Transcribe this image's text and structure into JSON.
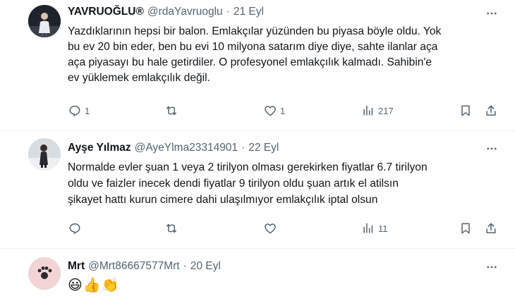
{
  "tweets": [
    {
      "name": "YAVRUOĞLU®",
      "handle": "@rdaYavruoglu",
      "separator": "·",
      "date": "21 Eyl",
      "lines": [
        "Yazdıklarının hepsi bir balon. Emlakçılar yüzünden bu piyasa böyle oldu. Yok",
        "bu ev 20 bin eder, ben bu evi 10 milyona satarım diye diye, sahte ilanlar aça",
        "aça piyasayı bu hale getirdiler. O profesyonel emlakçılık kalmadı. Sahibin'e",
        "ev yüklemek emlakçılık değil."
      ],
      "replies": "1",
      "retweets": "",
      "likes": "1",
      "views": "217"
    },
    {
      "name": "Ayşe Yılmaz",
      "handle": "@AyeYlma23314901",
      "separator": "·",
      "date": "22 Eyl",
      "lines": [
        "Normalde evler şuan 1 veya 2 tirilyon olması gerekirken fiyatlar 6.7 tirilyon",
        "oldu ve faizler inecek dendi fiyatlar 9 tirilyon oldu şuan artık el atilsın",
        "şikayet hattı kurun cimere dahi ulaşılmıyor emlakçılık iptal olsun"
      ],
      "replies": "",
      "retweets": "",
      "likes": "",
      "views": "11"
    },
    {
      "name": "Mrt",
      "handle": "@Mrt86667577Mrt",
      "separator": "·",
      "date": "20 Eyl",
      "emojis": "😃👍👏"
    }
  ],
  "colors": {
    "text": "#0f1419",
    "secondary": "#536471",
    "divider": "#eff3f4"
  },
  "icons": [
    "more-icon",
    "reply-icon",
    "retweet-icon",
    "like-icon",
    "views-icon",
    "bookmark-icon",
    "share-icon"
  ]
}
